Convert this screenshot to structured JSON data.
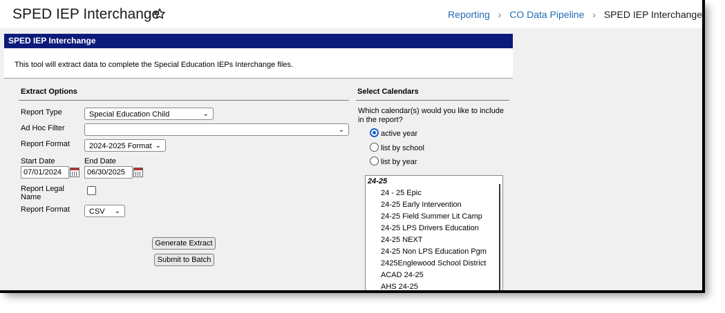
{
  "header": {
    "title": "SPED IEP Interchange",
    "breadcrumbs": [
      "Reporting",
      "CO Data Pipeline",
      "SPED IEP Interchange"
    ]
  },
  "panel": {
    "heading": "SPED IEP Interchange",
    "description": "This tool will extract data to complete the Special Education IEPs Interchange files."
  },
  "extract_options": {
    "heading": "Extract Options",
    "report_type_label": "Report Type",
    "report_type_value": "Special Education Child",
    "adhoc_label": "Ad Hoc Filter",
    "adhoc_value": "",
    "report_format_label": "Report Format",
    "report_format_value": "2024-2025 Format",
    "start_date_label": "Start Date",
    "start_date_value": "07/01/2024",
    "end_date_label": "End Date",
    "end_date_value": "06/30/2025",
    "legal_name_label_1": "Report Legal",
    "legal_name_label_2": "Name",
    "legal_name_checked": false,
    "file_format_label": "Report Format",
    "file_format_value": "CSV",
    "generate_button": "Generate Extract",
    "batch_button": "Submit to Batch"
  },
  "calendars": {
    "heading": "Select Calendars",
    "question_1": "Which calendar(s) would you like to include",
    "question_2": "in the report?",
    "options": [
      "active year",
      "list by school",
      "list by year"
    ],
    "selected_option": "active year",
    "group": "24-25",
    "items": [
      "24 - 25 Epic",
      "24-25 Early Intervention",
      "24-25 Field Summer Lit Camp",
      "24-25 LPS Drivers Education",
      "24-25 NEXT",
      "24-25 Non LPS Education Pgm",
      "2425Englewood School District",
      "ACAD 24-25",
      "AHS 24-25"
    ]
  },
  "colors": {
    "panel_header": "#0c1b7a",
    "link": "#1f6bb5",
    "radio_selected": "#1a5fc9"
  },
  "icons": [
    "star-icon",
    "chevron-right-icon",
    "chevron-down-icon",
    "calendar-icon"
  ]
}
